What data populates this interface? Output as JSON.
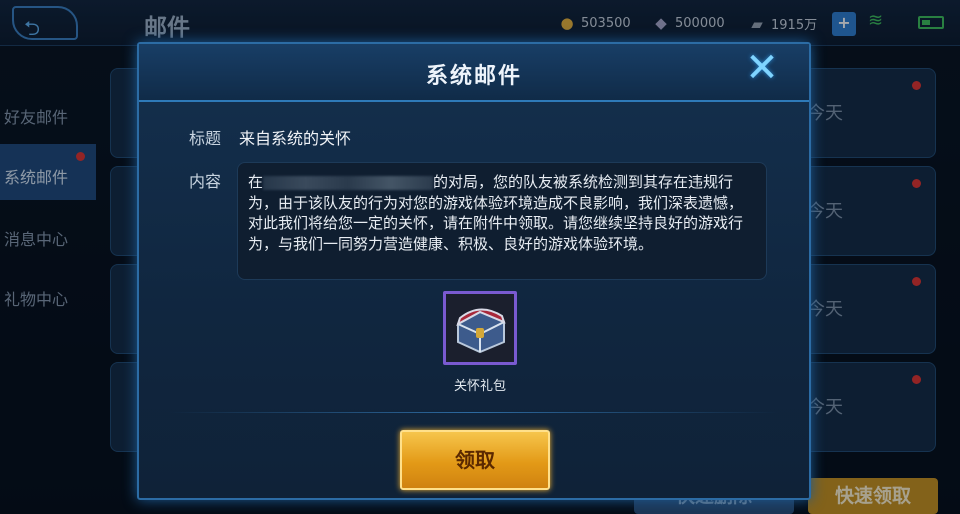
{
  "header": {
    "back_icon": "back-arrow-icon",
    "title": "邮件",
    "gold": "503500",
    "diamond": "500000",
    "vouchers": "1915万",
    "plus_icon": "plus-icon",
    "wifi_icon": "wifi-icon",
    "battery_icon": "battery-icon"
  },
  "sidebar": {
    "items": [
      {
        "label": "好友邮件"
      },
      {
        "label": "系统邮件"
      },
      {
        "label": "消息中心"
      },
      {
        "label": "礼物中心"
      }
    ]
  },
  "list": {
    "days": [
      "今天",
      "今天",
      "今天",
      "今天"
    ]
  },
  "bottom": {
    "delete_label": "快速删除",
    "collect_label": "快速领取"
  },
  "modal": {
    "title": "系统邮件",
    "close_icon": "close-x-icon",
    "subject_label": "标题",
    "subject_value": "来自系统的关怀",
    "content_label": "内容",
    "content_prefix": "在",
    "content_body": "的对局，您的队友被系统检测到其存在违规行为，由于该队友的行为对您的游戏体验环境造成不良影响，我们深表遗憾，对此我们将给您一定的关怀，请在附件中领取。请您继续坚持良好的游戏行为，与我们一同努力营造健康、积极、良好的游戏体验环境。",
    "gift_icon": "treasure-chest-icon",
    "gift_label": "关怀礼包",
    "claim_label": "领取"
  },
  "colors": {
    "accent": "#2c6ca5",
    "claim_button": "#e39a17",
    "notify_dot": "#e0342e"
  }
}
